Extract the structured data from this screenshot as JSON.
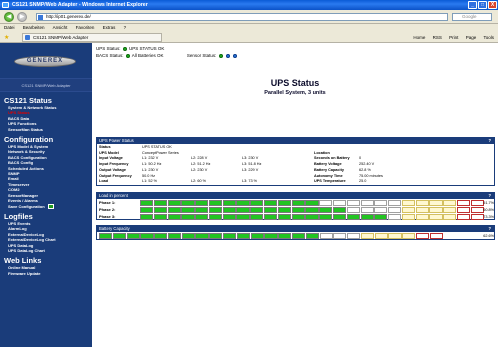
{
  "window": {
    "title": "CS121 SNMP/Web Adapter - Windows Internet Explorer",
    "min": "_",
    "max": "□",
    "close": "X"
  },
  "nav": {
    "url": "http://ip01.generex.de/",
    "search_placeholder": "Google"
  },
  "menu": [
    "Datei",
    "Bearbeiten",
    "Ansicht",
    "Favoriten",
    "Extras",
    "?"
  ],
  "tab": {
    "title": "CS121 SNMP/Web Adapter",
    "tools": [
      "Home",
      "RSS",
      "Print",
      "Page",
      "Tools"
    ]
  },
  "sidebar": {
    "logo": "GENEREX",
    "adapter": "CS121 SNMP/Web Adapter",
    "sections": [
      {
        "title": "CS121 Status",
        "items": [
          "System & Network Status",
          "UPS Status",
          "BACS Data",
          "UPS Functions",
          "SensorMan Status"
        ],
        "active": 1
      },
      {
        "title": "Configuration",
        "items": [
          "UPS Model & System",
          "Network & Security",
          "BACS Configuration",
          "BACS Config",
          "Scheduled Actions",
          "SNMP",
          "Email",
          "Timeserver",
          "COM2",
          "SensorManager",
          "Events / Alarms",
          "Save Configuration"
        ],
        "active": -1
      },
      {
        "title": "Logfiles",
        "items": [
          "UPS Events",
          "AlarmLog",
          "ExternalDeviceLog",
          "ExternalDeviceLog Chart",
          "UPS DataLog",
          "UPS DataLog Chart"
        ],
        "active": -1
      },
      {
        "title": "Web Links",
        "items": [
          "Online Manual",
          "Firmware Update"
        ],
        "active": -1
      }
    ]
  },
  "status": {
    "ups_label": "UPS Status:",
    "ups_value": "UPS STATUS OK",
    "bacs_label": "BACS Status:",
    "bacs_value": "All Batteries OK",
    "sensor_label": "Sensor Status:"
  },
  "header": {
    "title": "UPS Status",
    "subtitle": "Parallel System, 3 units"
  },
  "power": {
    "title": "UPS Power Status",
    "help": "?",
    "rows": [
      {
        "label": "Status",
        "l1": "UPS STATUS OK",
        "l2": "",
        "l3": "",
        "k": "",
        "v": ""
      },
      {
        "label": "UPS Model",
        "l1": "ConceptPower Series",
        "l2": "",
        "l3": "",
        "k": "Location",
        "v": ""
      },
      {
        "label": "Input Voltage",
        "l1": "L1: 232 V",
        "l2": "L2: 228 V",
        "l3": "L3: 230 V",
        "k": "Seconds on Battery",
        "v": "0"
      },
      {
        "label": "Input Frequency",
        "l1": "L1: 50.2 Hz",
        "l2": "L2: 51.2 Hz",
        "l3": "L3: 51.8 Hz",
        "k": "Battery Voltage",
        "v": "252.40 V"
      },
      {
        "label": "Output Voltage",
        "l1": "L1: 230 V",
        "l2": "L2: 230 V",
        "l3": "L3: 229 V",
        "k": "Battery Capacity",
        "v": "62.8 %"
      },
      {
        "label": "Output Frequency",
        "l1": "50.0 Hz",
        "l2": "",
        "l3": "",
        "k": "Autonomy Time",
        "v": "75.00 minutes"
      },
      {
        "label": "Load",
        "l1": "L1: 52 %",
        "l2": "L2: 60 %",
        "l3": "L3: 73 %",
        "k": "UPS Temperature",
        "v": "25.0"
      }
    ]
  },
  "load": {
    "title": "Load in percent",
    "help": "?",
    "phases": [
      {
        "label": "Phase 1:",
        "value": 51.7,
        "pct": "51.7%"
      },
      {
        "label": "Phase 2:",
        "value": 60.8,
        "pct": "60.8%"
      },
      {
        "label": "Phase 3:",
        "value": 73.3,
        "pct": "73.3%"
      }
    ]
  },
  "battery": {
    "title": "Battery Capacity",
    "help": "?",
    "value": 62.6,
    "pct": "62.6%"
  }
}
